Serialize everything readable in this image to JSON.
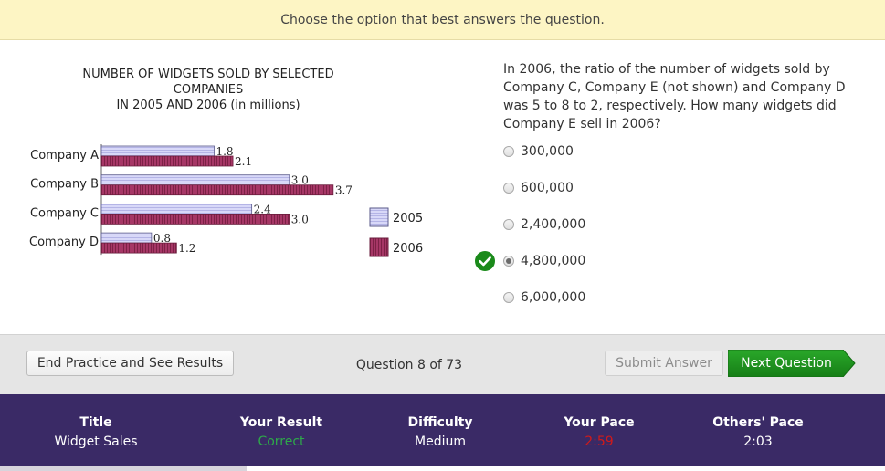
{
  "instruction": "Choose the option that best answers the question.",
  "question": {
    "text": "In 2006, the ratio of the number of widgets sold by Company C, Company E (not shown) and Company D was 5 to 8 to 2, respectively. How many widgets did Company E sell in 2006?",
    "options": [
      {
        "label": "300,000",
        "selected": false
      },
      {
        "label": "600,000",
        "selected": false
      },
      {
        "label": "2,400,000",
        "selected": false
      },
      {
        "label": "4,800,000",
        "selected": true,
        "correct": true
      },
      {
        "label": "6,000,000",
        "selected": false
      }
    ],
    "check_icon": "check-circle-icon"
  },
  "chart_data": {
    "type": "bar",
    "orientation": "horizontal",
    "title_line1": "NUMBER OF WIDGETS SOLD BY SELECTED COMPANIES",
    "title_line2": "IN 2005 AND 2006 (in millions)",
    "categories": [
      "Company A",
      "Company B",
      "Company C",
      "Company D"
    ],
    "series": [
      {
        "name": "2005",
        "values": [
          1.8,
          3.0,
          2.4,
          0.8
        ],
        "labels": [
          "1.8",
          "3.0",
          "2.4",
          "0.8"
        ],
        "color": "#d4d4f6",
        "stroke": "#5a5a8a"
      },
      {
        "name": "2006",
        "values": [
          2.1,
          3.7,
          3.0,
          1.2
        ],
        "labels": [
          "2.1",
          "3.7",
          "3.0",
          "1.2"
        ],
        "color": "#9c2f5a",
        "stroke": "#6a1d3c"
      }
    ],
    "legend": "right",
    "grid": false
  },
  "actions": {
    "end_label": "End Practice and See Results",
    "counter": "Question 8 of 73",
    "submit_label": "Submit Answer",
    "next_label": "Next Question"
  },
  "info": {
    "title_head": "Title",
    "title_val": "Widget Sales",
    "result_head": "Your Result",
    "result_val": "Correct",
    "result_color": "#2ea84a",
    "difficulty_head": "Difficulty",
    "difficulty_val": "Medium",
    "pace_head": "Your Pace",
    "pace_val": "2:59",
    "pace_color": "#d11a1a",
    "others_head": "Others' Pace",
    "others_val": "2:03"
  }
}
